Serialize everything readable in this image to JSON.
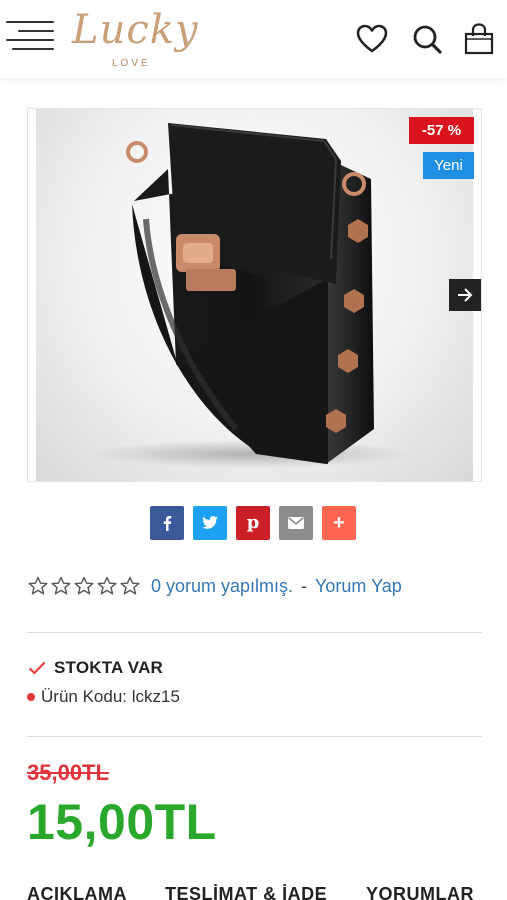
{
  "header": {
    "logo_main": "Lucky",
    "logo_sub": "LOVE",
    "icons": [
      "menu-icon",
      "heart-icon",
      "search-icon",
      "bag-icon"
    ]
  },
  "product": {
    "badge_discount": "-57 %",
    "badge_new": "Yeni",
    "image_icon": "black-leather-crossbody-bag"
  },
  "share": {
    "buttons": [
      {
        "icon": "facebook-icon",
        "glyph": "f",
        "color": "#3b5998"
      },
      {
        "icon": "twitter-icon",
        "glyph": "twitter",
        "color": "#1da1f2"
      },
      {
        "icon": "pinterest-icon",
        "glyph": "p",
        "color": "#cb2027"
      },
      {
        "icon": "email-icon",
        "glyph": "mail",
        "color": "#8c8c8c"
      },
      {
        "icon": "plus-icon",
        "glyph": "+",
        "color": "#ff6550"
      }
    ]
  },
  "rating": {
    "stars_filled": 0,
    "stars_total": 5,
    "reviews_link": "0 yorum yapılmış.",
    "separator": "-",
    "write_review": "Yorum Yap"
  },
  "stock": {
    "status": "STOKTA VAR",
    "code_label": "Ürün Kodu: lckz15",
    "check_color": "#e53935"
  },
  "price": {
    "old": "35,00TL",
    "new": "15,00TL",
    "old_color": "#e0333b",
    "new_color": "#2aa82c"
  },
  "tabs": [
    "AÇIKLAMA",
    "TESLİMAT & İADE",
    "YORUMLAR"
  ]
}
